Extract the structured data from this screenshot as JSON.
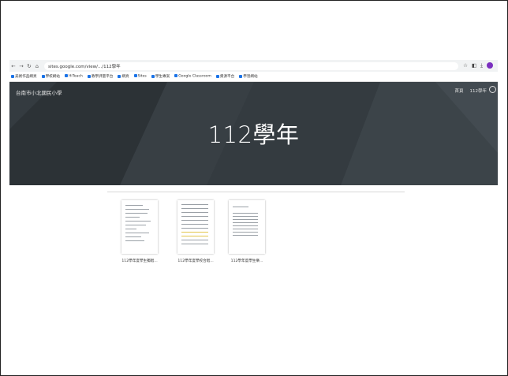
{
  "browser": {
    "url": "sites.google.com/view/.../112學年",
    "bookmarks": [
      "美術作品網頁",
      "學校網站",
      "HiTeach",
      "教學評量平台",
      "網頁",
      "Sites",
      "學生專案",
      "Google Classroom",
      "資源平台",
      "學習網站"
    ]
  },
  "site": {
    "name": "台南市小北國民小學",
    "nav": [
      "首頁",
      "112學年"
    ],
    "page_title": "112學年"
  },
  "documents": [
    {
      "caption": "112學年度學生獨唱..."
    },
    {
      "caption": "112學年度學校合唱..."
    },
    {
      "caption": "112學年度學生樂..."
    }
  ],
  "colors": {
    "banner": "#333a3f",
    "accent": "#1a73e8"
  }
}
